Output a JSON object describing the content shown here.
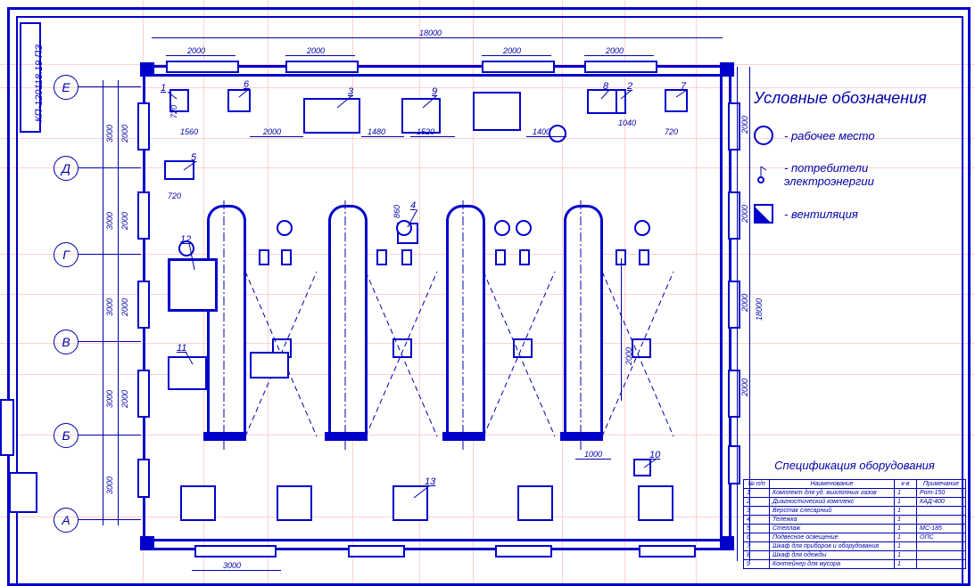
{
  "drawing_code": "КП-120118.19 ПЗ",
  "overall_dim_top": "18000",
  "overall_dim_right": "18000",
  "top_bay_dim": "2000",
  "bottom_gap_dim": "3000",
  "axes_rows": [
    "Е",
    "Д",
    "Г",
    "В",
    "Б",
    "А"
  ],
  "vert_axis_3000": "3000",
  "vert_axis_2000": "2000",
  "dims_row": [
    "2000",
    "1480",
    "1520",
    "1400"
  ],
  "dims_small": {
    "d1560": "1560",
    "d720a": "720",
    "d720b": "720",
    "d720c": "720",
    "d1040": "1040",
    "d860": "860",
    "d1000": "1000"
  },
  "callouts": {
    "1": "1",
    "2": "2",
    "3": "3",
    "4": "4",
    "5": "5",
    "6": "6",
    "7": "7",
    "8": "8",
    "9": "9",
    "10": "10",
    "11": "11",
    "12": "12",
    "13": "13"
  },
  "legend": {
    "title": "Условные обозначения",
    "workplace": "- рабочее место",
    "consumer": "- потребители электроэнергии",
    "ventilation": "- вентиляция"
  },
  "spec": {
    "title": "Спецификация оборудования",
    "headers": [
      "№ п/п",
      "Наименование",
      "к-в",
      "Примечание"
    ],
    "rows": [
      [
        "1",
        "Комплект для уд. выхлопных газов",
        "1",
        "Рот-150"
      ],
      [
        "2",
        "Диагностический комплекс",
        "1",
        "КАД-400"
      ],
      [
        "3",
        "Верстак слесарный",
        "1",
        ""
      ],
      [
        "4",
        "Тележка",
        "1",
        ""
      ],
      [
        "5",
        "Стеллаж",
        "1",
        "МС-185"
      ],
      [
        "6",
        "Подвесное освещение",
        "1",
        "ОПС"
      ],
      [
        "7",
        "Шкаф для приборов и оборудования",
        "1",
        ""
      ],
      [
        "8",
        "Шкаф для одежды",
        "1",
        ""
      ],
      [
        "9",
        "Контейнер для мусора",
        "1",
        ""
      ]
    ]
  }
}
